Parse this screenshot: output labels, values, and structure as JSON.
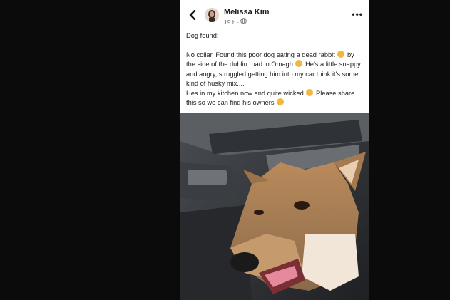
{
  "post": {
    "author": "Melissa Kim",
    "time": "19 h",
    "separator": "·",
    "body": {
      "title": "Dog found:",
      "line1_a": "No collar. Found this poor dog eating a dead rabbit",
      "line1_b": "by the side of the dublin road in Omagh",
      "line1_c": "He's a little snappy and angry, struggled getting him into my car think it's some kind of husky mix....",
      "line2_a": "Hes in my kitchen now and quite wicked",
      "line2_b": "Please share this so we can find his owners"
    },
    "icons": {
      "back": "back-arrow-icon",
      "privacy": "globe-icon",
      "more": "more-options-icon"
    },
    "colors": {
      "background": "#0b0b0c",
      "card": "#ffffff",
      "text": "#1c1e21",
      "meta": "#65676b"
    }
  }
}
